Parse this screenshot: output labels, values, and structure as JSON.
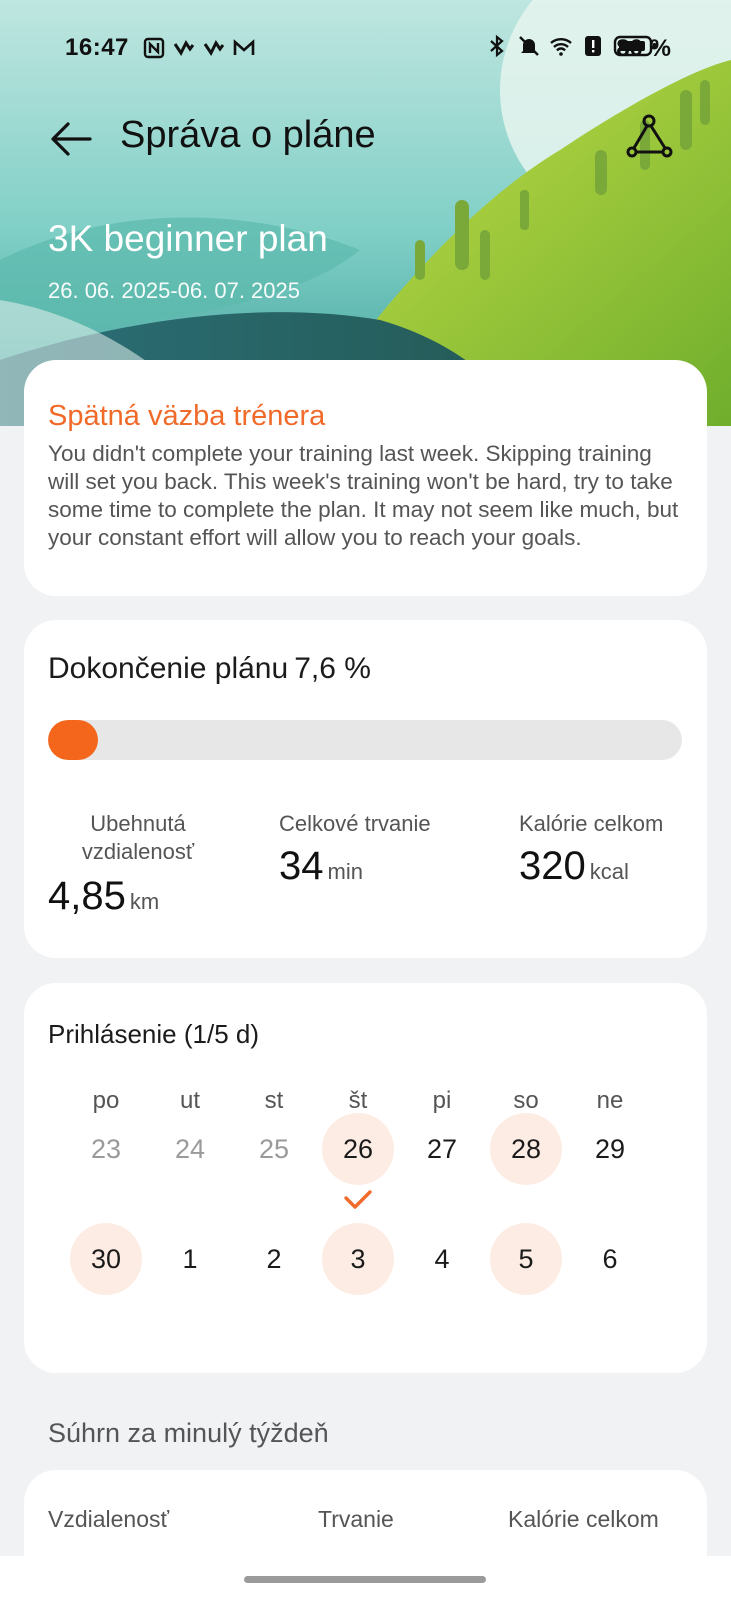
{
  "status_bar": {
    "time": "16:47",
    "battery_percent": "80 %",
    "left_icons": [
      "nfc-icon",
      "app-notification-icon",
      "app-notification-icon",
      "mail-icon"
    ],
    "right_icons": [
      "bluetooth-icon",
      "mute-icon",
      "wifi-icon",
      "alert-icon",
      "battery-icon"
    ]
  },
  "app_bar": {
    "title": "Správa o pláne",
    "back_icon": "arrow-left-icon",
    "route_icon": "route-icon"
  },
  "plan": {
    "name": "3K beginner plan",
    "dates": "26. 06. 2025-06. 07. 2025"
  },
  "feedback": {
    "title": "Spätná väzba trénera",
    "text": "You didn't complete your training last week. Skipping training will set you back. This week's training won't be hard, try to take some time to complete the plan. It may not seem like much, but your constant effort will allow you to reach your goals."
  },
  "completion": {
    "label": "Dokončenie plánu",
    "percent_text": "7,6 %",
    "progress_fraction": 0.076,
    "accent_color": "#f4661b",
    "stats": [
      {
        "label": "Ubehnutá vzdialenosť",
        "value": "4,85",
        "unit": "km"
      },
      {
        "label": "Celkové trvanie",
        "value": "34",
        "unit": "min"
      },
      {
        "label": "Kalórie celkom",
        "value": "320",
        "unit": "kcal"
      }
    ]
  },
  "checkin": {
    "title": "Prihlásenie (1/5 d)",
    "weekdays": [
      "po",
      "ut",
      "st",
      "št",
      "pi",
      "so",
      "ne"
    ],
    "weeks": [
      [
        {
          "day": "23",
          "state": "past"
        },
        {
          "day": "24",
          "state": "past"
        },
        {
          "day": "25",
          "state": "past"
        },
        {
          "day": "26",
          "state": "completed"
        },
        {
          "day": "27",
          "state": "normal"
        },
        {
          "day": "28",
          "state": "planned"
        },
        {
          "day": "29",
          "state": "normal"
        }
      ],
      [
        {
          "day": "30",
          "state": "planned"
        },
        {
          "day": "1",
          "state": "normal"
        },
        {
          "day": "2",
          "state": "normal"
        },
        {
          "day": "3",
          "state": "planned"
        },
        {
          "day": "4",
          "state": "normal"
        },
        {
          "day": "5",
          "state": "planned"
        },
        {
          "day": "6",
          "state": "normal"
        }
      ]
    ],
    "planned_color": "#fdece3",
    "check_color": "#f06a2a"
  },
  "summary": {
    "title": "Súhrn za minulý týždeň",
    "columns": [
      "Vzdialenosť",
      "Trvanie",
      "Kalórie celkom"
    ]
  }
}
